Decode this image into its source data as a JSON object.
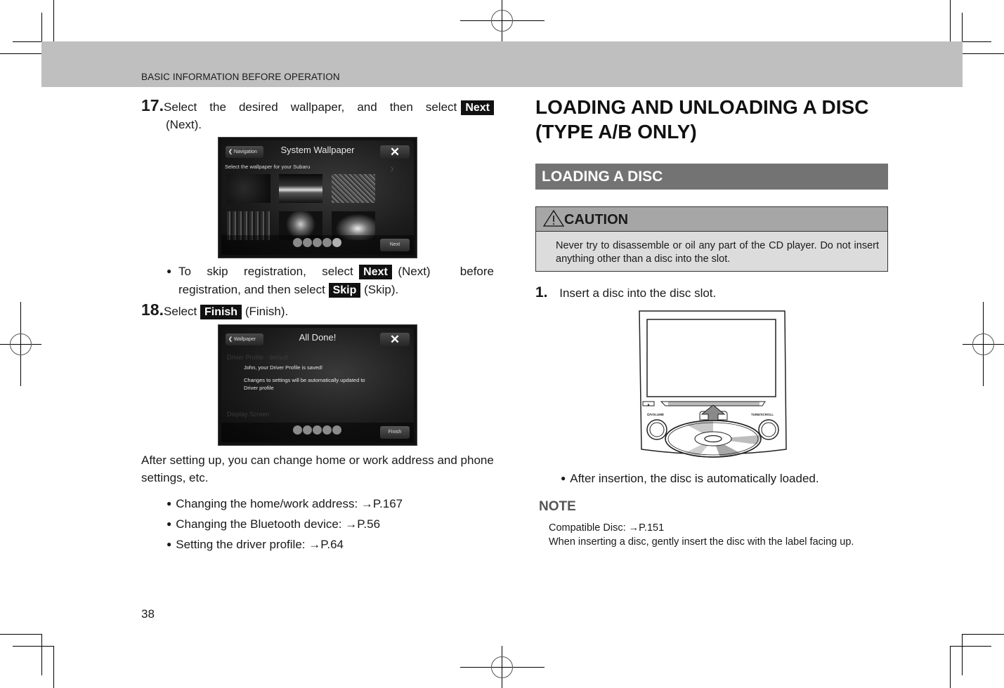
{
  "header": {
    "section_title": "BASIC INFORMATION BEFORE OPERATION"
  },
  "left_column": {
    "step17": {
      "number": "17.",
      "text_before": "Select the desired wallpaper, and then select",
      "button_label": "Next",
      "text_after": "(Next)."
    },
    "screen_wallpaper": {
      "back_label": "Navigation",
      "title": "System Wallpaper",
      "close_glyph": "✕",
      "subtitle": "Select the wallpaper for your Subaru",
      "next_label": "Next",
      "page_dots": 5,
      "active_dot": 5
    },
    "skip_bullet": {
      "text1": "To skip registration, select",
      "next_button": "Next",
      "text2": "(Next) before registration, and then select",
      "skip_button": "Skip",
      "text3": "(Skip)."
    },
    "step18": {
      "number": "18.",
      "text_before": "Select",
      "button_label": "Finish",
      "text_after": "(Finish)."
    },
    "screen_done": {
      "back_label": "Wallpaper",
      "title": "All Done!",
      "close_glyph": "✕",
      "bg_row1": "Driver Profile - default",
      "bg_row2": "Display Screen",
      "message1": "John, your Driver Profile is saved!",
      "message2": "Changes to settings will be automatically updated to Driver profile",
      "finish_label": "Finish",
      "page_dots": 5
    },
    "after_setup": "After setting up, you can change home or work address and phone settings, etc.",
    "links": [
      "Changing the home/work address: →P.167",
      "Changing the Bluetooth device: →P.56",
      "Setting the driver profile: →P.64"
    ]
  },
  "right_column": {
    "section_title_line1": "LOADING AND UNLOADING A DISC",
    "section_title_line2": "(TYPE A/B ONLY)",
    "subsection_title": "LOADING A DISC",
    "caution": {
      "title": "CAUTION",
      "icon_glyph": "!",
      "text": "Never try to disassemble or oil any part of the CD player. Do not insert anything other than a disc into the slot."
    },
    "step1": {
      "number": "1.",
      "text": "Insert a disc into the disc slot."
    },
    "illustration": {
      "left_knob_label": "⏻/VOLUME",
      "right_knob_label": "TUNE/SCROLL",
      "eject_glyph": "▲"
    },
    "after_insert": "After insertion, the disc is automatically loaded.",
    "note": {
      "title": "NOTE",
      "lines": [
        "Compatible Disc: →P.151",
        "When inserting a disc, gently insert the disc with the label facing up."
      ]
    }
  },
  "footer": {
    "page_number": "38"
  }
}
